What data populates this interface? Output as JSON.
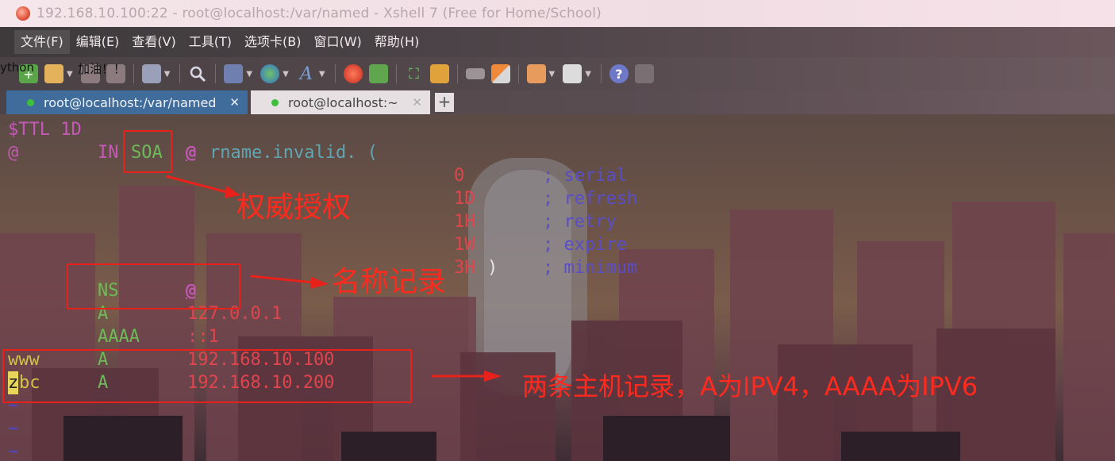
{
  "window": {
    "title": "192.168.10.100:22 - root@localhost:/var/named - Xshell 7 (Free for Home/School)"
  },
  "menu": {
    "items": [
      "文件(F)",
      "编辑(E)",
      "查看(V)",
      "工具(T)",
      "选项卡(B)",
      "窗口(W)",
      "帮助(H)"
    ]
  },
  "toolbar": {
    "overlay_left": "ython",
    "overlay_mid": "加油！！",
    "icons": [
      "new-session-icon",
      "open-folder-icon",
      "connect-icon",
      "disconnect-icon",
      "properties-icon",
      "find-icon",
      "transfer-icon",
      "globe-icon",
      "font-icon",
      "xftp-icon",
      "xagent-icon",
      "fullscreen-icon",
      "lock-icon",
      "keyboard-icon",
      "highlight-icon",
      "new-tab-folder-icon",
      "layout-icon",
      "help-icon",
      "chat-icon"
    ]
  },
  "tabs": [
    {
      "label": "root@localhost:/var/named",
      "active": true
    },
    {
      "label": "root@localhost:~",
      "active": false
    }
  ],
  "terminal": {
    "line1": "$TTL 1D",
    "line2_at": "@",
    "line2_in": "IN",
    "line2_soa": "SOA",
    "line2_at2": "@",
    "line2_rest": "rname.invalid. (",
    "soa_values": [
      {
        "value": "0",
        "comment": "; serial"
      },
      {
        "value": "1D",
        "comment": "; refresh"
      },
      {
        "value": "1H",
        "comment": "; retry"
      },
      {
        "value": "1W",
        "comment": "; expire"
      },
      {
        "value": "3H",
        "paren": ")",
        "comment": "; minimum"
      }
    ],
    "records": [
      {
        "name": "",
        "type": "NS",
        "value": "@"
      },
      {
        "name": "",
        "type": "A",
        "value": "127.0.0.1"
      },
      {
        "name": "",
        "type": "AAAA",
        "value": "::1"
      },
      {
        "name": "www",
        "type": "A",
        "value": "192.168.10.100"
      },
      {
        "name_cursor": "z",
        "name": "bc",
        "type": "A",
        "value": "192.168.10.200"
      }
    ],
    "tildes": [
      "~",
      "~",
      "~"
    ]
  },
  "annotations": {
    "soa_note": "权威授权",
    "ns_note": "名称记录",
    "host_note": "两条主机记录，A为IPV4，AAAA为IPV6",
    "color": "#ff2a1d"
  }
}
